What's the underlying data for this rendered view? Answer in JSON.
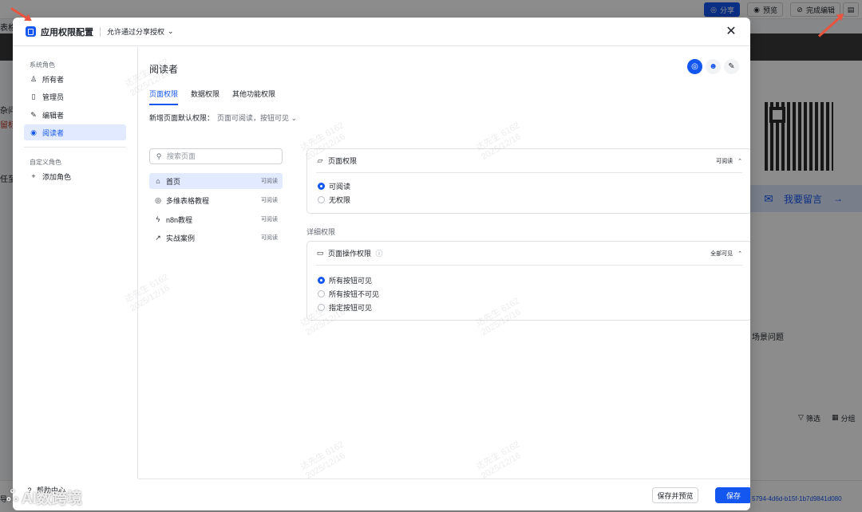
{
  "background": {
    "top_buttons": {
      "share": "分享",
      "preview": "预览",
      "finish_edit": "完成编辑"
    },
    "contact_label": "我要留言",
    "arrow_glyph": "→",
    "right_text": "场景问题",
    "filter_label": "筛选",
    "group_label": "分组",
    "left_snippets": [
      "杂问",
      "留标",
      "任至"
    ],
    "left_top_snippet": "表格",
    "left_bottom_snippet": "导",
    "row_id": "5794-4d6d-b15f-1b7d9841d080"
  },
  "modal": {
    "title": "应用权限配置",
    "share_mode": "允许通过分享授权",
    "sidebar": {
      "system_section": "系统角色",
      "system_roles": [
        "所有者",
        "管理员",
        "编辑者",
        "阅读者"
      ],
      "custom_section": "自定义角色",
      "add_role": "添加角色",
      "help": "帮助中心"
    },
    "main": {
      "role_title": "阅读者",
      "tabs": [
        "页面权限",
        "数据权限",
        "其他功能权限"
      ],
      "default_perm_label": "新增页面默认权限：",
      "default_perm_value": "页面可阅读，按钮可见",
      "search_placeholder": "搜索页面",
      "pages": [
        {
          "name": "首页",
          "perm": "可阅读"
        },
        {
          "name": "多维表格教程",
          "perm": "可阅读"
        },
        {
          "name": "n8n教程",
          "perm": "可阅读"
        },
        {
          "name": "实战案例",
          "perm": "可阅读"
        }
      ],
      "page_perm_panel": {
        "title": "页面权限",
        "summary": "可阅读",
        "options": [
          "可阅读",
          "无权限"
        ],
        "selected": 0
      },
      "detail_label": "详细权限",
      "op_perm_panel": {
        "title": "页面操作权限",
        "summary": "全部可见",
        "options": [
          "所有按钮可见",
          "所有按钮不可见",
          "指定按钮可见"
        ],
        "selected": 0
      }
    },
    "footer": {
      "save_preview": "保存并预览",
      "save": "保存"
    }
  },
  "watermark_text": "达先生 6162",
  "watermark_date": "2025/12/16",
  "brand_text": "AI数跨境",
  "colors": {
    "accent": "#1456f0",
    "active_bg": "#e1eaff",
    "annotation_arrow": "#e8543f"
  }
}
